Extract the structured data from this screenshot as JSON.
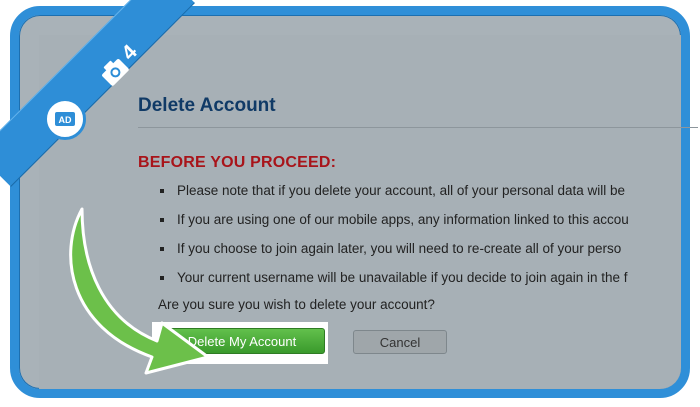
{
  "page": {
    "title": "Delete Account",
    "warning_heading": "BEFORE YOU PROCEED:",
    "notes": [
      "Please note that if you delete your account, all of your personal data will be",
      "If you are using one of our mobile apps, any information linked to this accou",
      "If you choose to join again later, you will need to re-create all of your perso",
      "Your current username will be unavailable if you decide to join again in the f"
    ],
    "question": "Are you sure you wish to delete your account?",
    "buttons": {
      "delete": "Delete My Account",
      "cancel": "Cancel"
    }
  },
  "overlay": {
    "step_number": "4",
    "badge_text": "AD",
    "icons": [
      "camera-icon",
      "badge-icon",
      "green-arrow-icon"
    ]
  },
  "colors": {
    "frame": "#2f8fd8",
    "background": "#a9b2b8",
    "title": "#103a66",
    "warning": "#a8141a",
    "delete_button": "#4aac38",
    "arrow": "#6cc04a"
  }
}
